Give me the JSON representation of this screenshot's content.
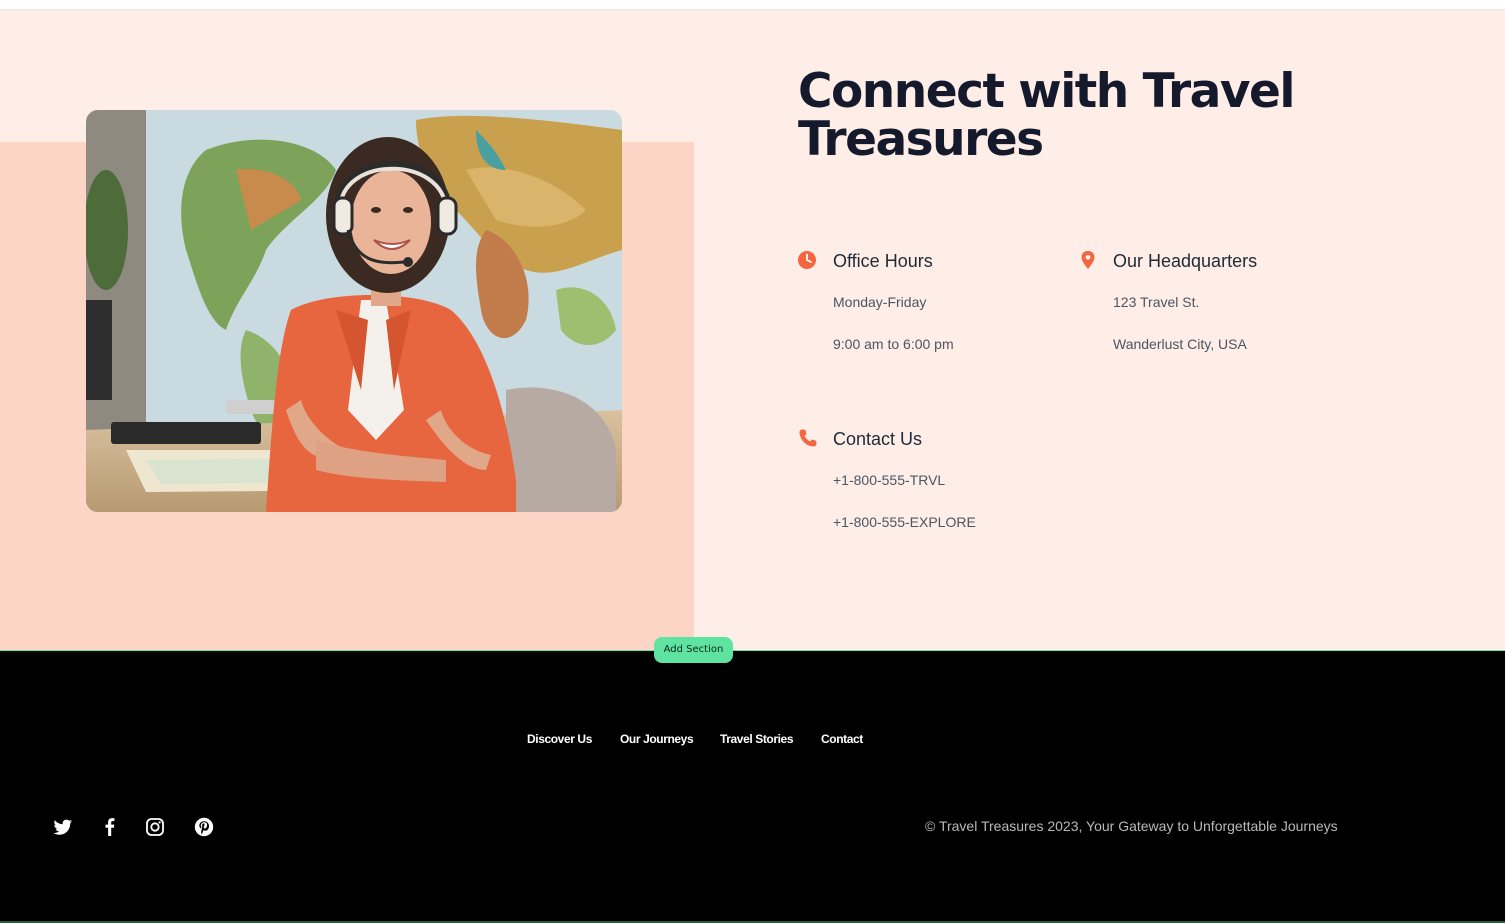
{
  "contact": {
    "heading_line1": "Connect with Travel",
    "heading_line2": "Treasures",
    "office_hours": {
      "icon": "clock-icon",
      "title": "Office Hours",
      "lines": [
        "Monday-Friday",
        "9:00 am to 6:00 pm"
      ]
    },
    "headquarters": {
      "icon": "map-pin-icon",
      "title": "Our Headquarters",
      "lines": [
        "123 Travel St.",
        "Wanderlust City, USA"
      ]
    },
    "contact_us": {
      "icon": "phone-icon",
      "title": "Contact Us",
      "lines": [
        "+1-800-555-TRVL",
        "+1-800-555-EXPLORE"
      ]
    },
    "photo": {
      "subject": "agent-with-headset-photo"
    }
  },
  "editor": {
    "add_section_label": "Add Section"
  },
  "footer": {
    "nav": [
      "Discover Us",
      "Our Journeys",
      "Travel Stories",
      "Contact"
    ],
    "social": [
      "twitter-icon",
      "facebook-icon",
      "instagram-icon",
      "pinterest-icon"
    ],
    "copyright": "© Travel Treasures 2023, Your Gateway to Unforgettable Journeys"
  },
  "colors": {
    "accent": "#f26640",
    "section_bg": "#feeee7",
    "peach_block": "#fdd5c6",
    "heading": "#141a2c",
    "footer_bg": "#000000",
    "add_section_bg": "#5fe3a1"
  }
}
